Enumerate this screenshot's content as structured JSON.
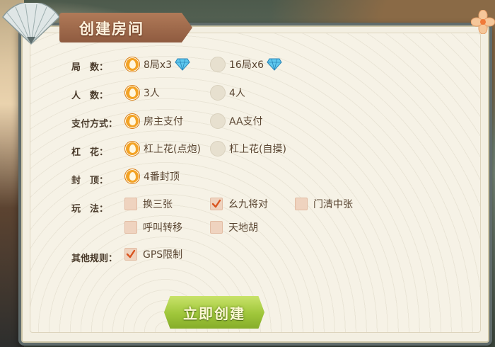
{
  "dialog": {
    "title": "创建房间"
  },
  "rows": {
    "rounds": {
      "label": "局　数：",
      "opt1": "8局x3",
      "opt2": "16局x6"
    },
    "players": {
      "label": "人　数：",
      "opt1": "3人",
      "opt2": "4人"
    },
    "payment": {
      "label": "支付方式：",
      "opt1": "房主支付",
      "opt2": "AA支付"
    },
    "gang": {
      "label": "杠　花：",
      "opt1": "杠上花(点炮)",
      "opt2": "杠上花(自摸)"
    },
    "cap": {
      "label": "封　顶：",
      "opt1": "4番封顶"
    },
    "play": {
      "label": "玩　法：",
      "opt1": "换三张",
      "opt2": "幺九将对",
      "opt3": "门清中张",
      "opt4": "呼叫转移",
      "opt5": "天地胡"
    },
    "other": {
      "label": "其他规则：",
      "opt1": "GPS限制"
    }
  },
  "state": {
    "rounds_selected": "8局x3",
    "players_selected": "3人",
    "payment_selected": "房主支付",
    "gang_selected": "杠上花(点炮)",
    "cap_selected": "4番封顶",
    "play_checked": [
      "幺九将对"
    ],
    "other_checked": [
      "GPS限制"
    ]
  },
  "buttons": {
    "create": "立即创建"
  },
  "colors": {
    "accent": "#f3a325",
    "panel": "#f3efe2",
    "button": "#9fc63a",
    "banner": "#a06a4c"
  },
  "icons": {
    "gem": "diamond-icon",
    "close": "flower-close-icon",
    "fan": "fan-icon"
  }
}
